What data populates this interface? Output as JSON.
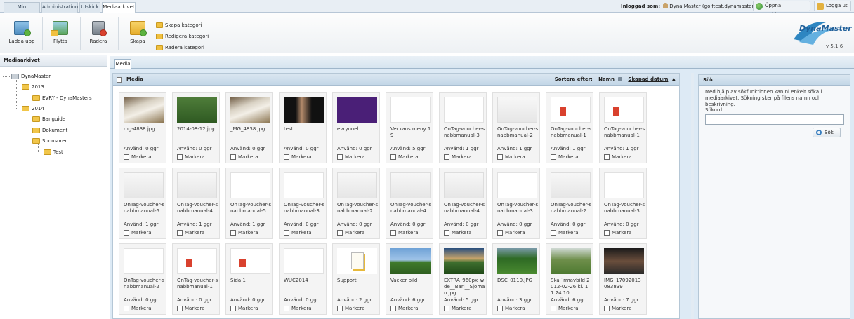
{
  "top_tabs": [
    "Min webbplats",
    "Administration",
    "Utskick",
    "Mediaarkivet"
  ],
  "user": {
    "label": "Inloggad som:",
    "name": "Dyna Master (golftest.dynamaster.se)"
  },
  "top_buttons": {
    "open_site": "Öppna webbplatsen",
    "logout": "Logga ut"
  },
  "toolbar": {
    "upload": "Ladda upp",
    "move": "Flytta",
    "delete": "Radera",
    "create": "Skapa",
    "create_category": "Skapa kategori",
    "edit_category": "Redigera kategori",
    "delete_category": "Radera kategori"
  },
  "logo": {
    "text": "DynaMaster",
    "version": "v 5.1.6"
  },
  "left_panel": {
    "title": "Mediaarkivet"
  },
  "tree": [
    "DynaMaster",
    "2013",
    "EVRY - DynaMasters",
    "2014",
    "Banguide",
    "Dokument",
    "Sponsorer",
    "Test"
  ],
  "media_tab": "Media",
  "media_header": {
    "title": "Media",
    "sort_label": "Sortera efter:",
    "sort_name": "Namn",
    "sort_date": "Skapad datum"
  },
  "mark_label": "Markera",
  "items": [
    {
      "name": "mg-4838.jpg",
      "used": "Använd: 0 ggr",
      "thumb": "photo-food"
    },
    {
      "name": "2014-08-12.jpg",
      "used": "Använd: 0 ggr",
      "thumb": "photo-golfer"
    },
    {
      "name": "_MG_4838.jpg",
      "used": "Använd: 0 ggr",
      "thumb": "photo-food"
    },
    {
      "name": "test",
      "used": "Använd: 0 ggr",
      "thumb": "photo-portrait"
    },
    {
      "name": "evryonel",
      "used": "Använd: 0 ggr",
      "thumb": "evry-logo"
    },
    {
      "name": "Veckans meny 19",
      "used": "Använd: 5 ggr",
      "thumb": "document"
    },
    {
      "name": "OnTag-voucher-snabbmanual-3",
      "used": "Använd: 1 ggr",
      "thumb": "document"
    },
    {
      "name": "OnTag-voucher-snabbmanual-2",
      "used": "Använd: 1 ggr",
      "thumb": "document-gray"
    },
    {
      "name": "OnTag-voucher-snabbmanual-1",
      "used": "Använd: 1 ggr",
      "thumb": "document-red"
    },
    {
      "name": "OnTag-voucher-snabbmanual-1",
      "used": "Använd: 1 ggr",
      "thumb": "document-red"
    },
    {
      "name": "OnTag-voucher-snabbmanual-6",
      "used": "Använd: 1 ggr",
      "thumb": "document-gray"
    },
    {
      "name": "OnTag-voucher-snabbmanual-4",
      "used": "Använd: 1 ggr",
      "thumb": "document-gray"
    },
    {
      "name": "OnTag-voucher-snabbmanual-5",
      "used": "Använd: 1 ggr",
      "thumb": "document-phone"
    },
    {
      "name": "OnTag-voucher-snabbmanual-3",
      "used": "Använd: 0 ggr",
      "thumb": "document"
    },
    {
      "name": "OnTag-voucher-snabbmanual-2",
      "used": "Använd: 0 ggr",
      "thumb": "document-gray"
    },
    {
      "name": "OnTag-voucher-snabbmanual-4",
      "used": "Använd: 0 ggr",
      "thumb": "document-gray"
    },
    {
      "name": "OnTag-voucher-snabbmanual-4",
      "used": "Använd: 0 ggr",
      "thumb": "document-gray"
    },
    {
      "name": "OnTag-voucher-snabbmanual-3",
      "used": "Använd: 0 ggr",
      "thumb": "document"
    },
    {
      "name": "OnTag-voucher-snabbmanual-2",
      "used": "Använd: 0 ggr",
      "thumb": "document-gray"
    },
    {
      "name": "OnTag-voucher-snabbmanual-3",
      "used": "Använd: 0 ggr",
      "thumb": "document"
    },
    {
      "name": "OnTag-voucher-snabbmanual-2",
      "used": "Använd: 0 ggr",
      "thumb": "document"
    },
    {
      "name": "OnTag-voucher-snabbmanual-1",
      "used": "Använd: 0 ggr",
      "thumb": "document-red"
    },
    {
      "name": "Sida 1",
      "used": "Använd: 0 ggr",
      "thumb": "document-red"
    },
    {
      "name": "WUC2014",
      "used": "Använd: 0 ggr",
      "thumb": "document-poster"
    },
    {
      "name": "Support",
      "used": "Använd: 2 ggr",
      "thumb": "file-icon"
    },
    {
      "name": "Vacker bild",
      "used": "Använd: 6 ggr",
      "thumb": "photo-course"
    },
    {
      "name": "EXTRA_960px_wide__Bari__Sjoman.jpg",
      "used": "Använd: 5 ggr",
      "thumb": "photo-sunset"
    },
    {
      "name": "DSC_0110.JPG",
      "used": "Använd: 3 ggr",
      "thumb": "photo-green"
    },
    {
      "name": "Skal¨rmavbild 2012-02-26 kl. 11.24.10",
      "used": "Använd: 6 ggr",
      "thumb": "photo-field"
    },
    {
      "name": "IMG_17092013_083839",
      "used": "Använd: 7 ggr",
      "thumb": "photo-crowd"
    }
  ],
  "search": {
    "title": "Sök",
    "help": "Med hjälp av sökfunktionen kan ni enkelt söka i mediaarkivet. Sökning sker på filens namn och beskrivning.",
    "label": "Sökord",
    "value": "",
    "button": "Sök"
  }
}
